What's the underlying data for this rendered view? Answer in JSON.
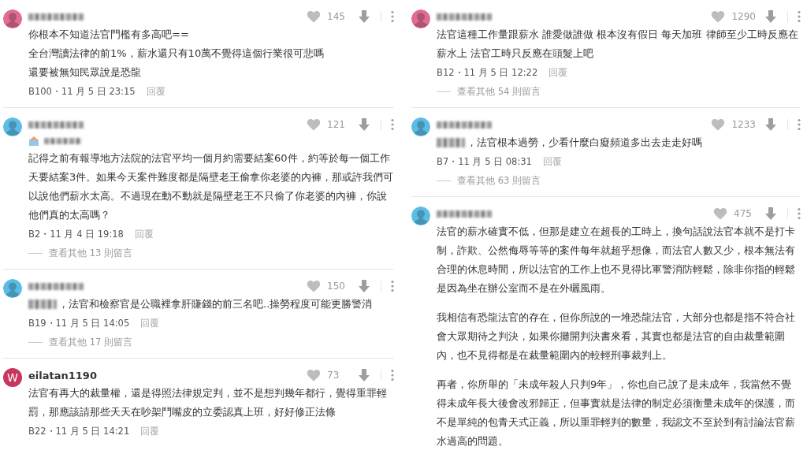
{
  "columns": [
    {
      "comments": [
        {
          "avatar": {
            "kind": "silhouette",
            "color": "#e06b93"
          },
          "likes": "145",
          "paragraphs": [
            "你根本不知道法官門檻有多高吧==",
            "全台灣讀法律的前1%，薪水還只有10萬不覺得這個行業很可悲嗎",
            "還要被無知民眾說是恐龍"
          ],
          "floor": "B100・11 月 5 日 23:15",
          "reply": "回覆"
        },
        {
          "avatar": {
            "kind": "silhouette",
            "color": "#5bbde6"
          },
          "badge_blurred": true,
          "likes": "121",
          "paragraphs": [
            "記得之前有報導地方法院的法官平均一個月約需要結案60件，約等於每一個工作天要結案3件。如果今天案件難度都是隔壁老王偷拿你老婆的內褲，那或許我們可以說他們薪水太高。不過現在動不動就是隔壁老王不只偷了你老婆的內褲，你說他們真的太高嗎？"
          ],
          "floor": "B2・11 月 4 日 19:18",
          "reply": "回覆",
          "more": "查看其他 13 則留言"
        },
        {
          "avatar": {
            "kind": "silhouette",
            "color": "#5bbde6"
          },
          "mention_blurred": true,
          "likes": "150",
          "paragraphs": [
            "，法官和檢察官是公職裡拿肝賺錢的前三名吧..操勞程度可能更勝警消"
          ],
          "floor": "B19・11 月 5 日 14:05",
          "reply": "回覆",
          "more": "查看其他 17 則留言"
        },
        {
          "avatar": {
            "kind": "letter",
            "color": "#c8365e",
            "letter": "W"
          },
          "name": "eilatan1190",
          "likes": "73",
          "paragraphs": [
            "法官有再大的裁量權，還是得照法律規定判，並不是想判幾年都行，覺得重罪輕罰，那應該請那些天天在吵架鬥嘴皮的立委認真上班，好好修正法條"
          ],
          "floor": "B22・11 月 5 日 14:21",
          "reply": "回覆"
        }
      ]
    },
    {
      "comments": [
        {
          "avatar": {
            "kind": "silhouette",
            "color": "#e06b93"
          },
          "likes": "1290",
          "paragraphs": [
            "法官這種工作量跟薪水 誰愛做誰做 根本沒有假日 每天加班 律師至少工時反應在薪水上 法官工時只反應在頭髮上吧"
          ],
          "floor": "B12・11 月 5 日 12:22",
          "reply": "回覆",
          "more": "查看其他 54 則留言"
        },
        {
          "avatar": {
            "kind": "silhouette",
            "color": "#5bbde6"
          },
          "mention_blurred": true,
          "likes": "1233",
          "paragraphs": [
            "，法官根本過勞，少看什麼白癡頻道多出去走走好嗎"
          ],
          "floor": "B7・11 月 5 日 08:31",
          "reply": "回覆",
          "more": "查看其他 63 則留言"
        },
        {
          "avatar": {
            "kind": "silhouette",
            "color": "#5bbde6"
          },
          "likes": "475",
          "paragraph_gap": true,
          "paragraphs": [
            "法官的薪水確實不低，但那是建立在超長的工時上，換句話說法官本就不是打卡制，詐欺、公然侮辱等等的案件每年就超乎想像，而法官人數又少，根本無法有合理的休息時間，所以法官的工作上也不見得比軍警消防輕鬆，除非你指的輕鬆是因為坐在辦公室而不是在外曬風雨。",
            "我相信有恐龍法官的存在，但你所說的一堆恐龍法官，大部分也都是指不符合社會大眾期待之判決，如果你攤開判決書來看，其實也都是法官的自由裁量範圍內，也不見得都是在裁量範圍內的較輕刑事裁判上。",
            "再者，你所舉的「未成年殺人只判9年」，你也自己說了是未成年，我當然不覺得未成年長大後會改邪歸正，但事實就是法律的制定必須衡量未成年的保護，而不是單純的包青天式正義，所以重罪輕判的數量，我認文不至於到有討論法官薪水過高的問題。"
          ]
        }
      ]
    }
  ]
}
